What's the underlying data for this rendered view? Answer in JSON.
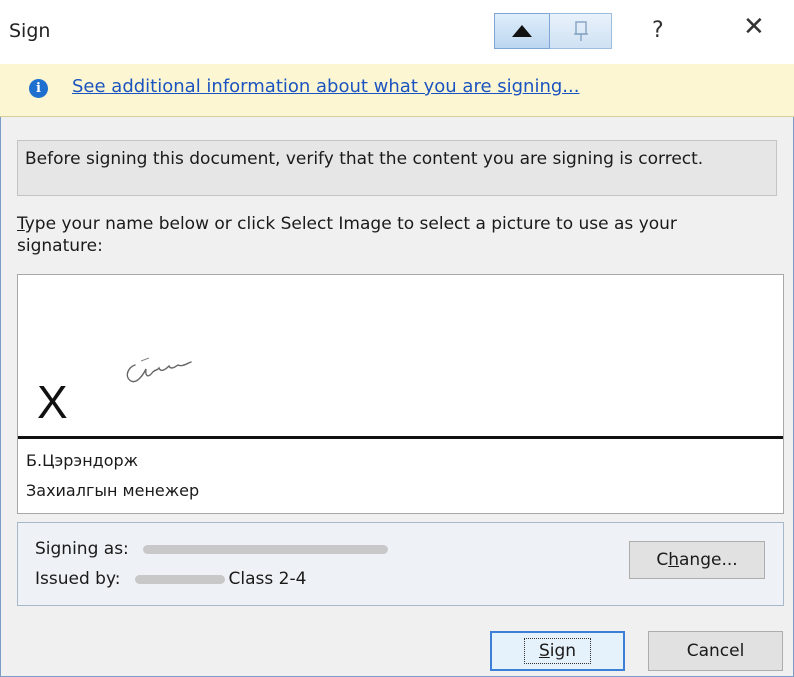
{
  "window": {
    "title": "Sign",
    "help_label": "?",
    "close_label": "✕"
  },
  "infobar": {
    "link_text": "See additional information about what you are signing..."
  },
  "verify_message": "Before signing this document, verify that the content you are signing is correct.",
  "instruction": {
    "first_letter": "T",
    "rest": "ype your name below or click Select Image to select a picture to use as your signature:"
  },
  "signature": {
    "x_mark": "X",
    "signer_name": "Б.Цэрэндорж",
    "signer_title": "Захиалгын менежер"
  },
  "certificate": {
    "signing_as_label": "Signing as:",
    "issued_by_label": "Issued by:",
    "issued_by_suffix": "Class 2-4",
    "change_label_pre": "C",
    "change_label_u": "h",
    "change_label_post": "ange..."
  },
  "buttons": {
    "sign_u": "S",
    "sign_rest": "ign",
    "cancel": "Cancel"
  },
  "colors": {
    "accent": "#3c7fd6",
    "link": "#1b54c0",
    "infobar_bg": "#fcf7d2"
  }
}
